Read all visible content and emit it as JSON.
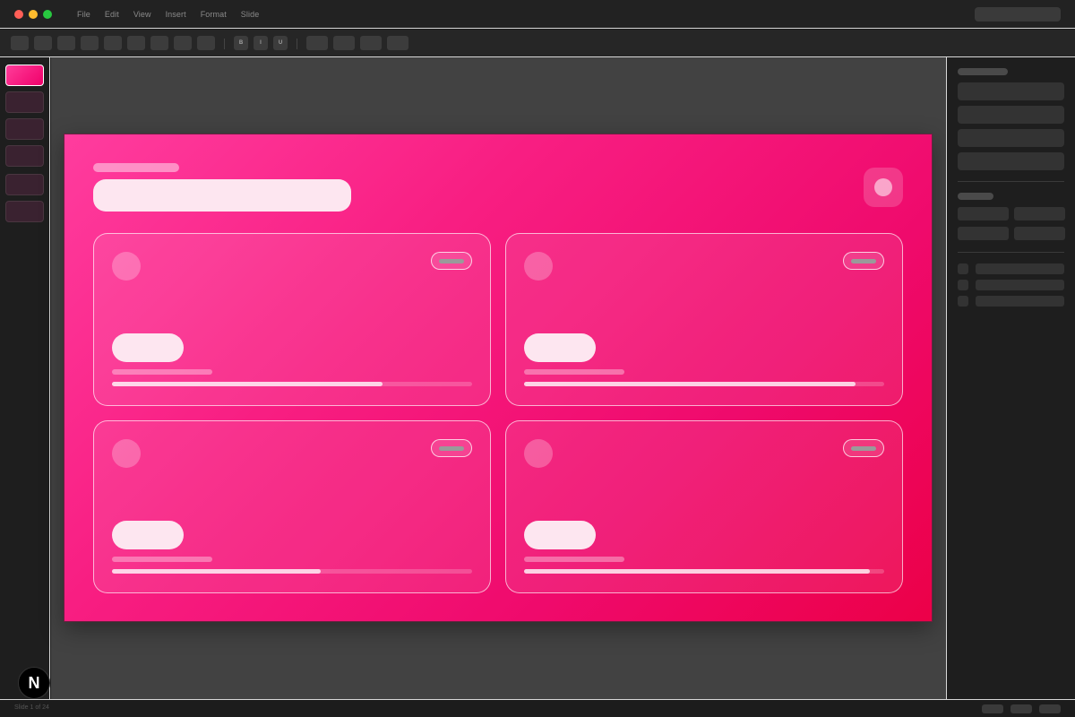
{
  "window": {
    "traffic_lights": [
      "close",
      "minimize",
      "zoom"
    ]
  },
  "menu": {
    "items": [
      "File",
      "Edit",
      "View",
      "Insert",
      "Format",
      "Slide"
    ]
  },
  "toolbar": {
    "format_buttons": [
      "B",
      "I",
      "U"
    ]
  },
  "colors": {
    "slide_gradient_start": "#ff3c9e",
    "slide_gradient_end": "#ec0048",
    "chrome_bg": "#222222",
    "canvas_bg": "#424242"
  },
  "slide": {
    "cards": [
      {
        "progress": 0.75
      },
      {
        "progress": 0.92
      },
      {
        "progress": 0.58
      },
      {
        "progress": 0.96
      }
    ]
  },
  "statusbar": {
    "slide_counter": "Slide 1 of 24"
  },
  "badge": {
    "letter": "N"
  }
}
